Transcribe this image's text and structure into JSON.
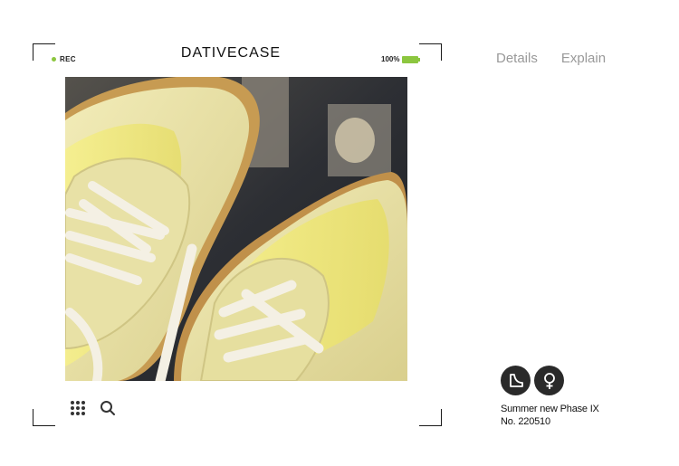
{
  "app": {
    "brand": "DATIVECASE"
  },
  "status": {
    "rec_label": "REC",
    "battery_label": "100%",
    "battery_level_percent": 100
  },
  "colors": {
    "accent_green": "#8cc63f",
    "tab_inactive": "#999999",
    "badge_bg": "#2a2a2a"
  },
  "tabs": [
    {
      "label": "Details"
    },
    {
      "label": "Explain"
    }
  ],
  "toolbar": {
    "grid_icon": "grid-dots-icon",
    "search_icon": "search-icon"
  },
  "badges": [
    {
      "icon": "shoe-size-icon"
    },
    {
      "icon": "female-icon"
    }
  ],
  "caption": {
    "line1": "Summer new Phase IX",
    "line2": "No. 220510"
  }
}
